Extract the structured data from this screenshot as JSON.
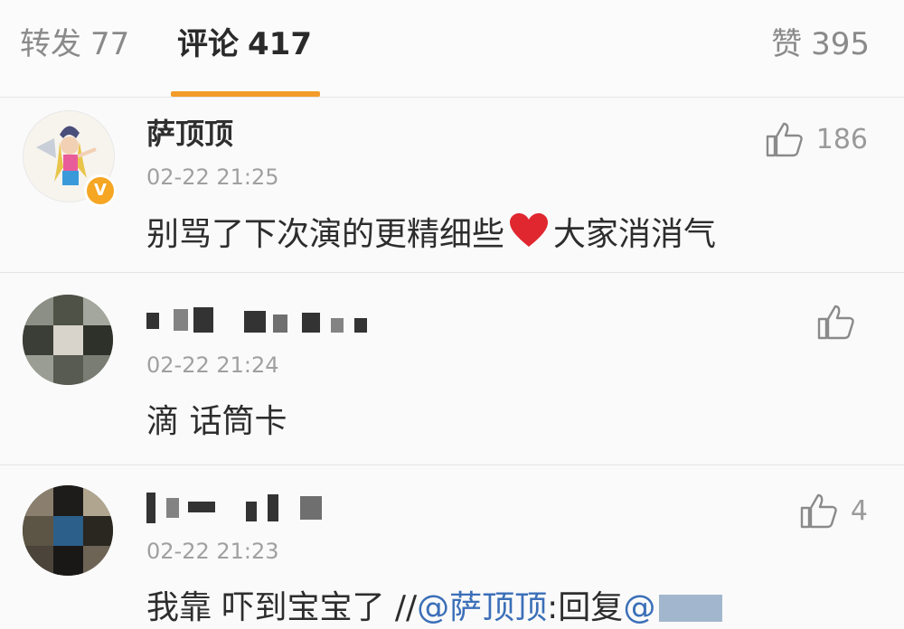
{
  "tabs": {
    "repost": {
      "label": "转发",
      "count": "77"
    },
    "comments": {
      "label": "评论",
      "count": "417"
    },
    "likes": {
      "label": "赞",
      "count": "395"
    }
  },
  "comments": [
    {
      "name": "萨顶顶",
      "time": "02-22 21:25",
      "text_before_emoji": "别骂了下次演的更精细些",
      "text_after_emoji": "大家消消气",
      "likes": "186",
      "verified": true
    },
    {
      "time": "02-22 21:24",
      "text": "滴 话筒卡",
      "likes": ""
    },
    {
      "time": "02-22 21:23",
      "text": "我靠  吓到宝宝了  //",
      "mention": "@萨顶顶",
      "text_tail": ":回复",
      "mention2": "@",
      "likes": "4"
    }
  ],
  "colors": {
    "accent": "#f39c2a",
    "mention": "#3b6fb8",
    "emoji": "#e0262f"
  },
  "icons": {
    "like": "thumbs-up-icon",
    "verified": "verified-badge-icon",
    "emoji": "heart-icon"
  }
}
